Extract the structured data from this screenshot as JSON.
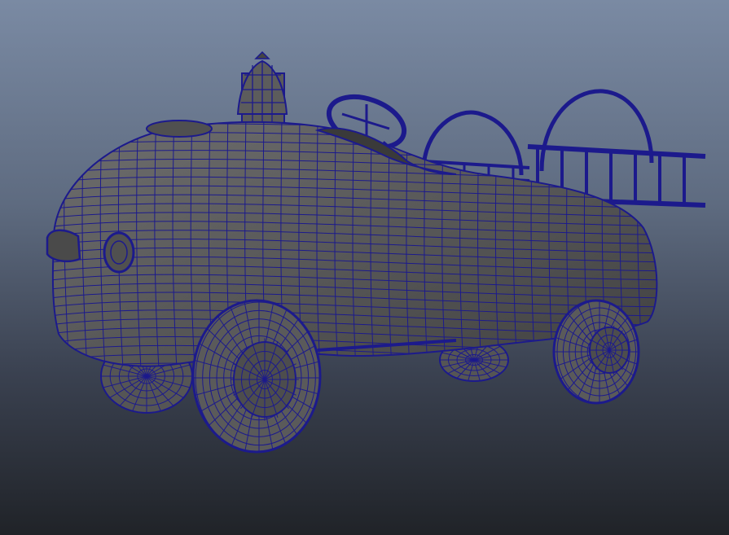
{
  "viewport": {
    "background_top": "#7a8aa3",
    "background_bottom": "#202328",
    "display_mode": "wireframe-on-shaded"
  },
  "model": {
    "subject": "fire-truck-pedal-car",
    "wire_color": "#1c1a8c",
    "shaded_color": "#5a5a5a",
    "shaded_dark": "#3c3c3c",
    "shaded_light": "#6e6e6e",
    "parts": [
      "body",
      "bell",
      "steering-wheel",
      "ladder",
      "ladder-rails",
      "front-wheel",
      "rear-wheel",
      "headlight"
    ]
  }
}
